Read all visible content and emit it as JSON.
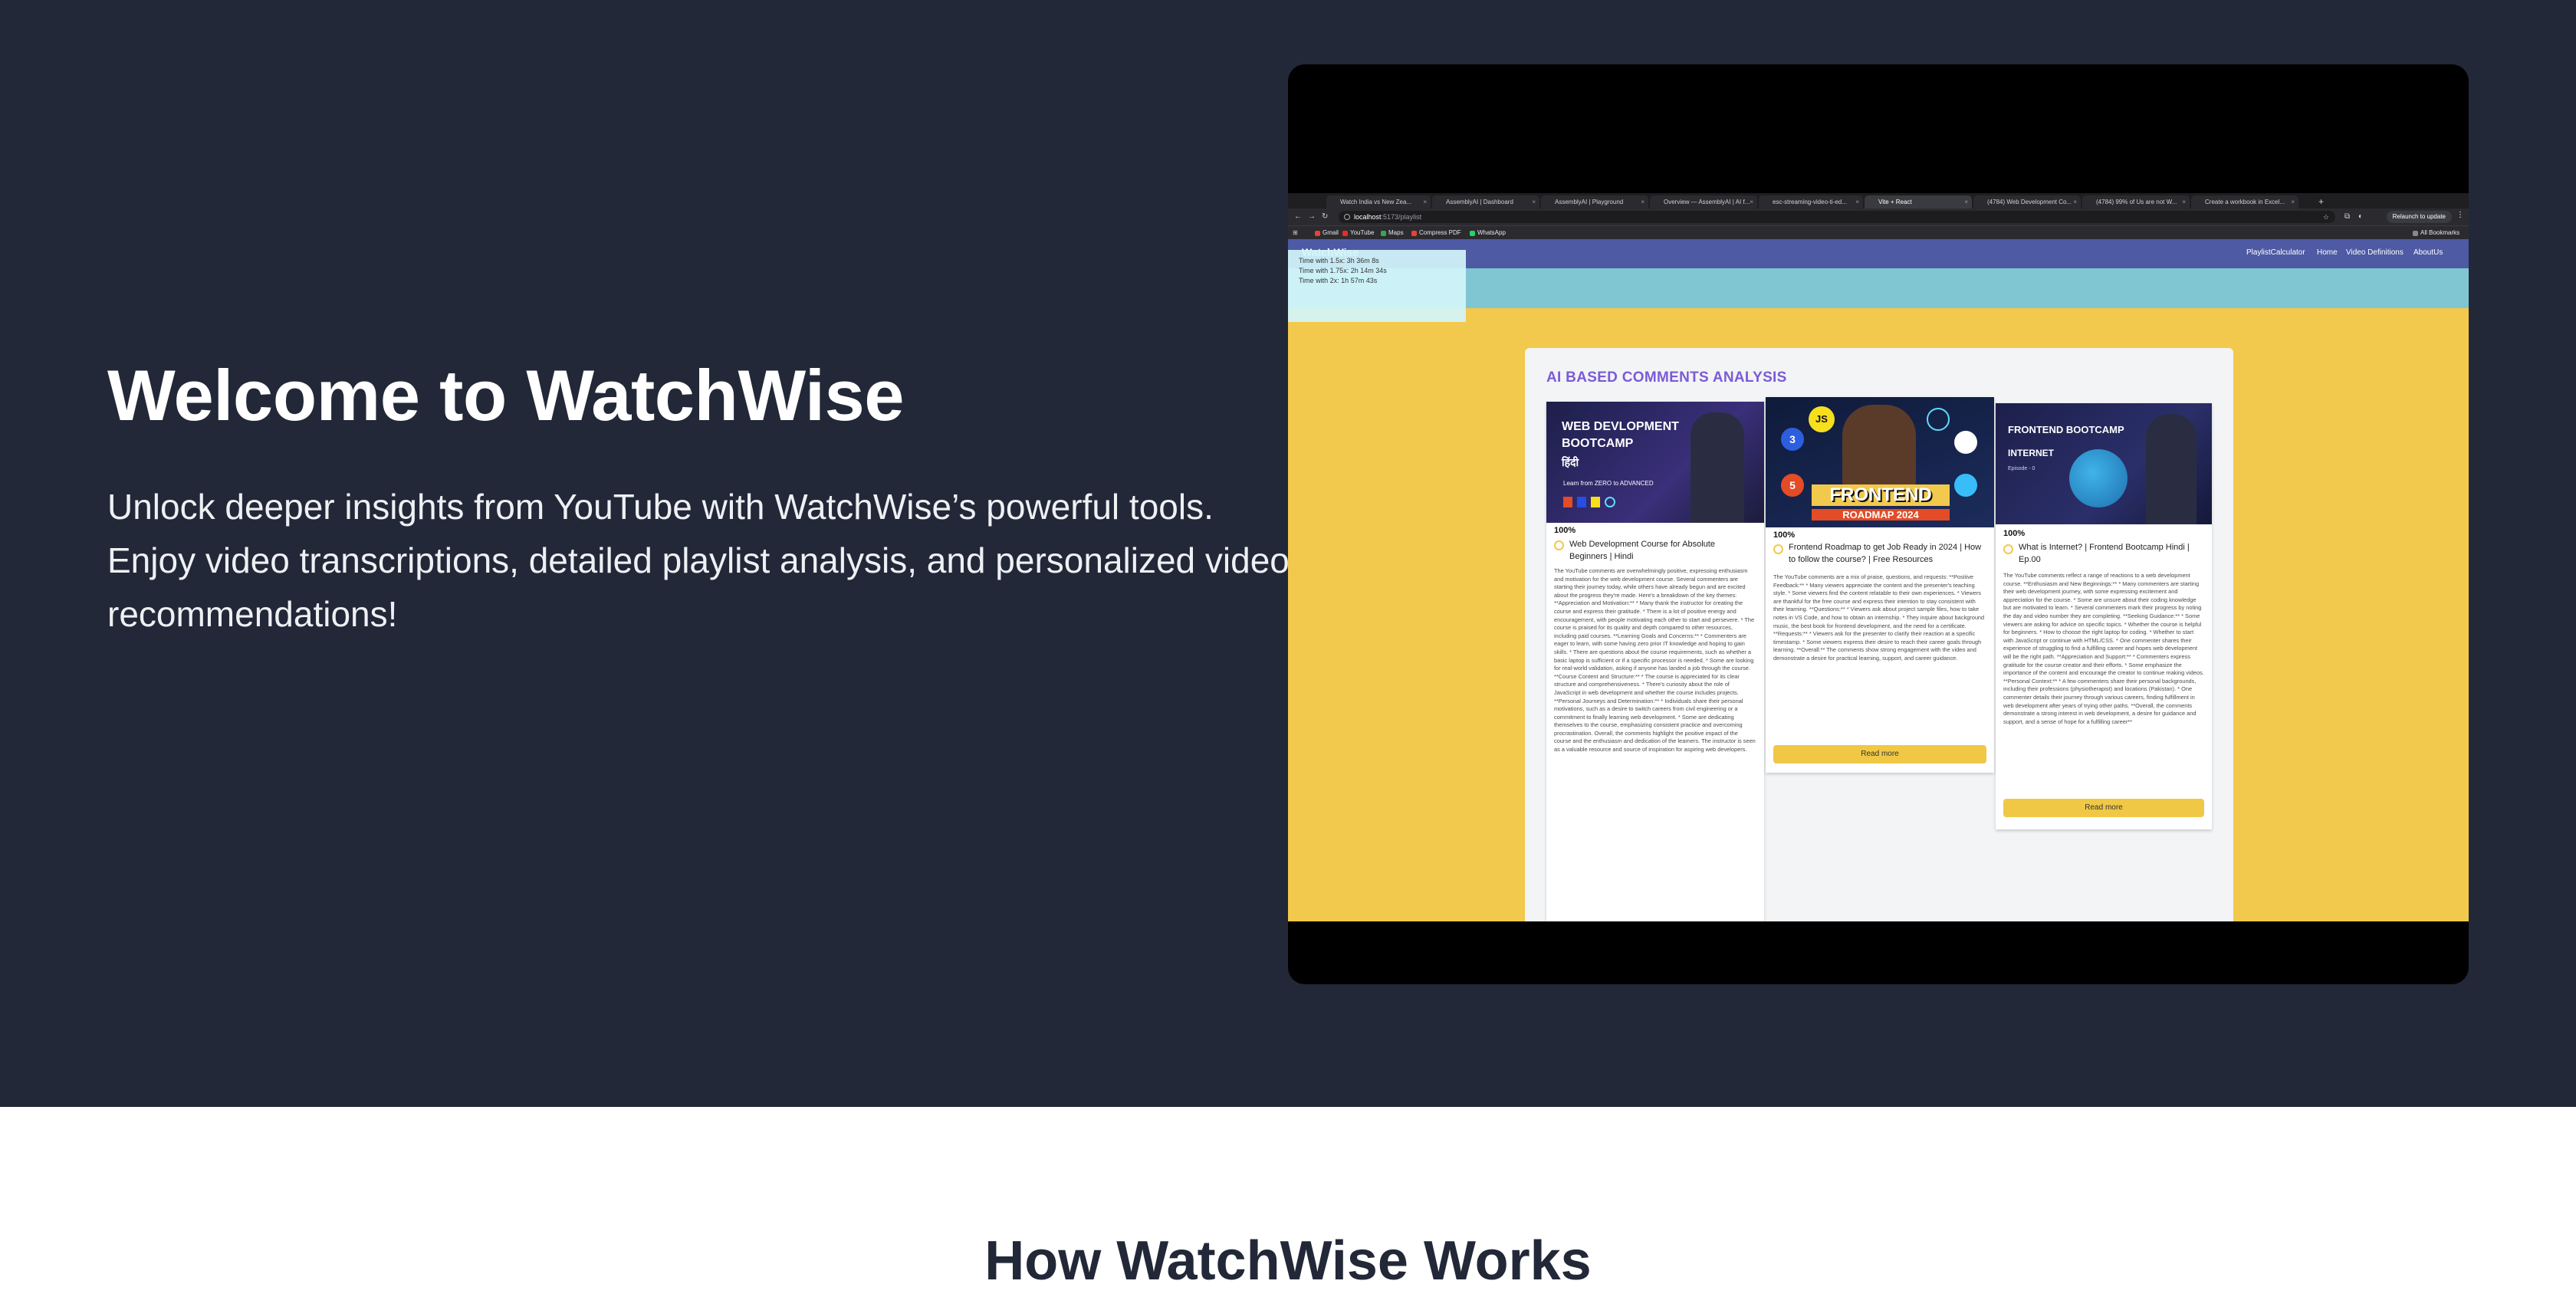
{
  "hero": {
    "title": "Welcome to WatchWise",
    "subtitle": "Unlock deeper insights from YouTube with WatchWise’s powerful tools. Enjoy video transcriptions, detailed playlist analysis, and personalized video recommendations!"
  },
  "browser": {
    "tabs": [
      {
        "label": "Watch India vs New Zea...",
        "color": "#e7554f"
      },
      {
        "label": "AssemblyAI | Dashboard",
        "color": "#3b5bdb"
      },
      {
        "label": "AssemblyAI | Playground",
        "color": "#3b5bdb"
      },
      {
        "label": "Overview — AssemblyAI | AI f...",
        "color": "#111111"
      },
      {
        "label": "esc-streaming-video-ti-ed...",
        "color": "#888888"
      },
      {
        "label": "Vite + React",
        "color": "#9b6cf0"
      },
      {
        "label": "(4784) Web Development Co...",
        "color": "#e52d27"
      },
      {
        "label": "(4784) 99% of Us are not W...",
        "color": "#e52d27"
      },
      {
        "label": "Create a workbook in Excel...",
        "color": "#21a366"
      }
    ],
    "url_host": "localhost",
    "url_path": ":5173/playlist",
    "relaunch": "Relaunch to update",
    "all_bookmarks": "All Bookmarks",
    "bookmarks": [
      {
        "label": "Gmail",
        "color": "#e94235"
      },
      {
        "label": "YouTube",
        "color": "#e52d27"
      },
      {
        "label": "Maps",
        "color": "#34a853"
      },
      {
        "label": "Compress PDF",
        "color": "#e94235"
      },
      {
        "label": "WhatsApp",
        "color": "#25d366"
      }
    ]
  },
  "app": {
    "brand": "WatchWise",
    "nav": [
      "PlaylistCalculator",
      "Home",
      "Video Definitions",
      "AboutUs"
    ],
    "times": [
      "Time with 1.5x: 3h 36m 8s",
      "Time with 1.75x: 2h 14m 34s",
      "Time with 2x: 1h 57m 43s"
    ],
    "section_title": "AI BASED COMMENTS ANALYSIS",
    "cards": [
      {
        "thumb_title": "WEB DEVLOPMENT BOOTCAMP",
        "thumb_hindi": "हिंदी",
        "thumb_sub": "Learn from ZERO to ADVANCED",
        "percent": "100%",
        "title": "Web Development Course for Absolute Beginners | Hindi",
        "desc": "The YouTube comments are overwhelmingly positive, expressing enthusiasm and motivation for the web development course. Several commenters are starting their journey today, while others have already begun and are excited about the progress they're made. Here's a breakdown of the key themes: **Appreciation and Motivation:** * Many thank the instructor for creating the course and express their gratitude. * There is a lot of positive energy and encouragement, with people motivating each other to start and persevere. * The course is praised for its quality and depth compared to other resources, including paid courses. **Learning Goals and Concerns:** * Commenters are eager to learn, with some having zero prior IT knowledge and hoping to gain skills. * There are questions about the course requirements, such as whether a basic laptop is sufficient or if a specific processor is needed. * Some are looking for real-world validation, asking if anyone has landed a job through the course. **Course Content and Structure:** * The course is appreciated for its clear structure and comprehensiveness. * There's curiosity about the role of JavaScript in web development and whether the course includes projects. **Personal Journeys and Determination:** * Individuals share their personal motivations, such as a desire to switch careers from civil engineering or a commitment to finally learning web development. * Some are dedicating themselves to the course, emphasizing consistent practice and overcoming procrastination. Overall, the comments highlight the positive impact of the course and the enthusiasm and dedication of the learners. The instructor is seen as a valuable resource and source of inspiration for aspiring web developers."
      },
      {
        "thumb_title": "FRONTEND",
        "thumb_sub": "ROADMAP 2024",
        "percent": "100%",
        "title": "Frontend Roadmap to get Job Ready in 2024 | How to follow the course? | Free Resources",
        "desc": "The YouTube comments are a mix of praise, questions, and requests: **Positive Feedback:** * Many viewers appreciate the content and the presenter's teaching style. * Some viewers find the content relatable to their own experiences. * Viewers are thankful for the free course and express their intention to stay consistent with their learning. **Questions:** * Viewers ask about project sample files, how to take notes in VS Code, and how to obtain an internship. * They inquire about background music, the best book for frontend development, and the need for a certificate. **Requests:** * Viewers ask for the presenter to clarify their reaction at a specific timestamp. * Some viewers express their desire to reach their career goals through learning. **Overall:** The comments show strong engagement with the video and demonstrate a desire for practical learning, support, and career guidance.",
        "read_more": "Read more"
      },
      {
        "thumb_title": "FRONTEND BOOTCAMP",
        "thumb_sub": "INTERNET",
        "thumb_ep": "Episode - 0",
        "percent": "100%",
        "title": "What is Internet? | Frontend Bootcamp Hindi | Ep.00",
        "desc": "The YouTube comments reflect a range of reactions to a web development course. **Enthusiasm and New Beginnings:** * Many commenters are starting their web development journey, with some expressing excitement and appreciation for the course. * Some are unsure about their coding knowledge but are motivated to learn. * Several commenters mark their progress by noting the day and video number they are completing. **Seeking Guidance:** * Some viewers are asking for advice on specific topics. * Whether the course is helpful for beginners. * How to choose the right laptop for coding. * Whether to start with JavaScript or continue with HTML/CSS. * One commenter shares their experience of struggling to find a fulfilling career and hopes web development will be the right path. **Appreciation and Support:** * Commenters express gratitude for the course creator and their efforts. * Some emphasize the importance of the content and encourage the creator to continue making videos. **Personal Context:** * A few commenters share their personal backgrounds, including their professions (physiotherapist) and locations (Pakistan). * One commenter details their journey through various careers, finding fulfillment in web development after years of trying other paths. **Overall, the comments demonstrate a strong interest in web development, a desire for guidance and support, and a sense of hope for a fulfilling career**",
        "read_more": "Read more"
      }
    ]
  },
  "how": {
    "title": "How WatchWise Works"
  },
  "colors": {
    "hero_bg": "#222837",
    "app_nav": "#4e5aa3",
    "app_bg": "#f2c94c",
    "accent_purple": "#7b5bd6",
    "button": "#f0c846"
  }
}
